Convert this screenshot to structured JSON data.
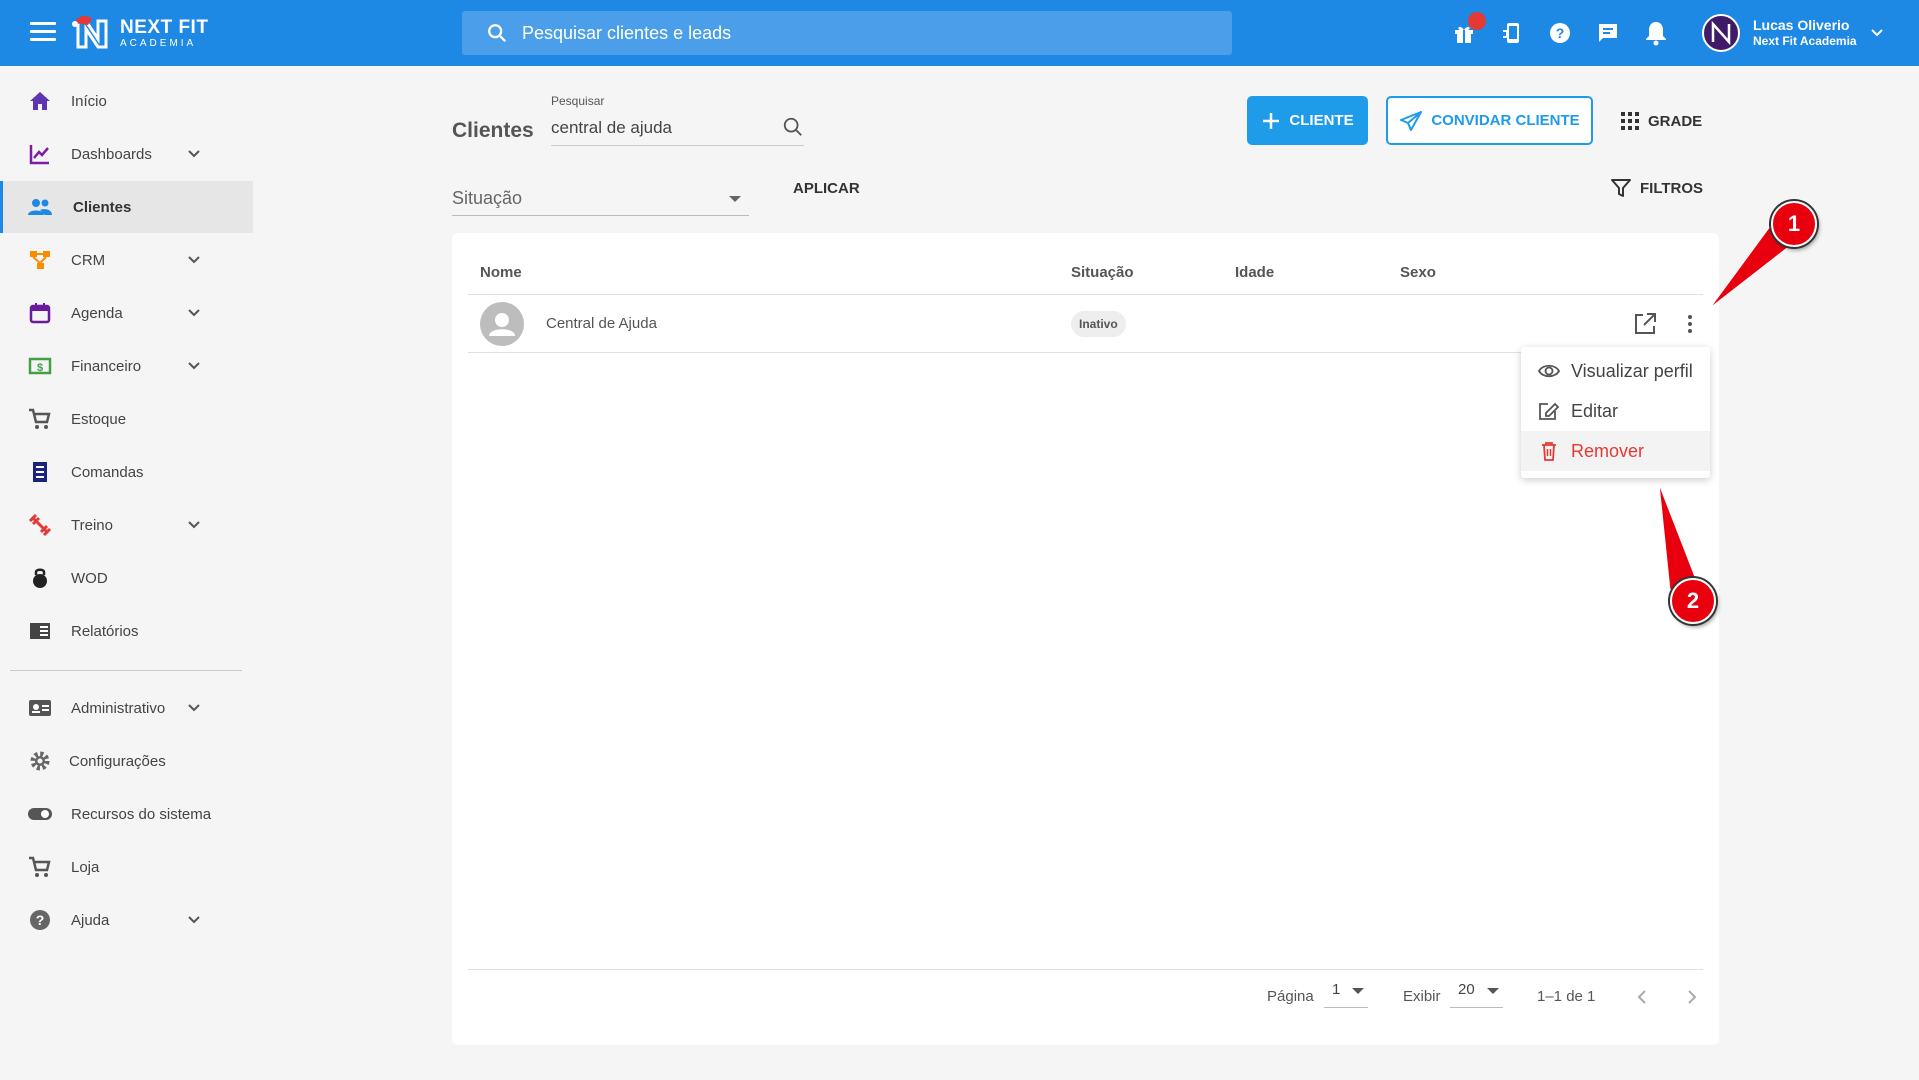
{
  "app": {
    "logo_line1": "NEXT FIT",
    "logo_line2": "ACADEMIA",
    "search_placeholder": "Pesquisar clientes e leads",
    "user_name": "Lucas Oliverio",
    "user_company": "Next Fit Academia",
    "avatar_letter": "N",
    "accent": "#1e88e5"
  },
  "top_icons": [
    "gift-icon",
    "phone-sync-icon",
    "help-icon",
    "chat-icon",
    "bell-icon"
  ],
  "sidebar": {
    "items": [
      {
        "label": "Início",
        "icon": "home-icon",
        "color": "#5e35b1"
      },
      {
        "label": "Dashboards",
        "icon": "chart-line-icon",
        "color": "#7b1fa2",
        "expand": true
      },
      {
        "label": "Clientes",
        "icon": "people-icon",
        "color": "#1e88e5",
        "active": true
      },
      {
        "label": "CRM",
        "icon": "crm-icon",
        "color": "#fb8c00",
        "expand": true
      },
      {
        "label": "Agenda",
        "icon": "calendar-icon",
        "color": "#6a1b9a",
        "expand": true
      },
      {
        "label": "Financeiro",
        "icon": "money-icon",
        "color": "#43a047",
        "expand": true
      },
      {
        "label": "Estoque",
        "icon": "cart-icon",
        "color": "#555"
      },
      {
        "label": "Comandas",
        "icon": "receipt-icon",
        "color": "#1a237e"
      },
      {
        "label": "Treino",
        "icon": "dumbbell-icon",
        "color": "#e53935",
        "expand": true
      },
      {
        "label": "WOD",
        "icon": "kettlebell-icon",
        "color": "#222"
      },
      {
        "label": "Relatórios",
        "icon": "report-icon",
        "color": "#444"
      },
      {
        "label": "Administrativo",
        "icon": "id-card-icon",
        "color": "#555",
        "expand": true
      },
      {
        "label": "Configurações",
        "icon": "gear-icon",
        "color": "#666"
      },
      {
        "label": "Recursos do sistema",
        "icon": "toggle-icon",
        "color": "#555"
      },
      {
        "label": "Loja",
        "icon": "cart-icon",
        "color": "#555"
      },
      {
        "label": "Ajuda",
        "icon": "help-icon",
        "color": "#666",
        "expand": true
      }
    ]
  },
  "page": {
    "title": "Clientes",
    "search_label": "Pesquisar",
    "search_value": "central de ajuda",
    "btn_cliente": "CLIENTE",
    "btn_convidar": "CONVIDAR CLIENTE",
    "btn_grade": "GRADE",
    "situacao_placeholder": "Situação",
    "aplicar": "APLICAR",
    "filtros": "FILTROS"
  },
  "table": {
    "headers": [
      "Nome",
      "Situação",
      "Idade",
      "Sexo"
    ],
    "rows": [
      {
        "nome": "Central de Ajuda",
        "situacao": "Inativo",
        "idade": "",
        "sexo": ""
      }
    ],
    "menu": [
      "Visualizar perfil",
      "Editar",
      "Remover"
    ]
  },
  "pagination": {
    "page_label": "Página",
    "page_value": "1",
    "show_label": "Exibir",
    "show_value": "20",
    "range": "1–1 de 1"
  },
  "annotations": [
    "1",
    "2"
  ]
}
